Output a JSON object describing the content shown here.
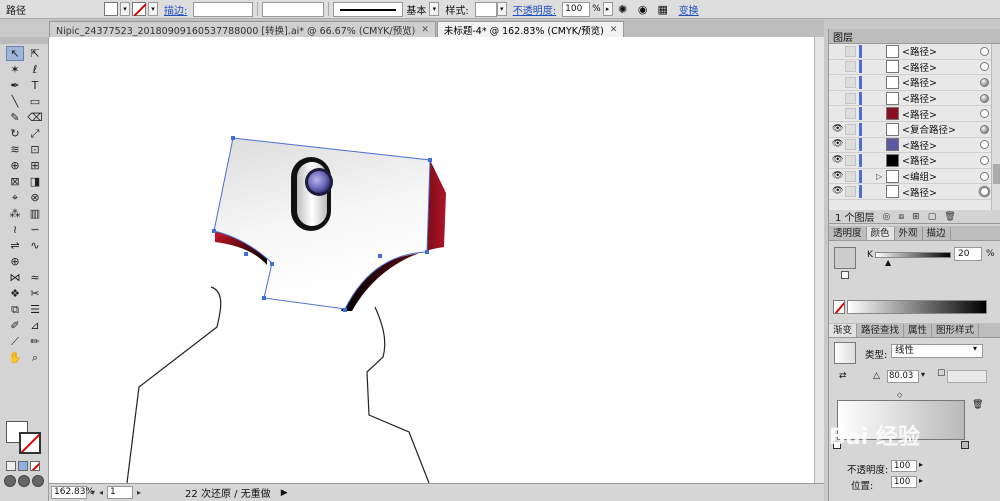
{
  "control_bar": {
    "selection_label": "路径",
    "stroke_label": "描边:",
    "brush_label": "基本",
    "style_label": "样式:",
    "opacity_label": "不透明度:",
    "opacity_value": "100",
    "opacity_unit": "%",
    "transform_label": "变换"
  },
  "tabs": [
    {
      "label": "Nipic_24377523_20180909160537788000 [转换].ai* @ 66.67% (CMYK/预览)"
    },
    {
      "label": "未标题-4* @ 162.83% (CMYK/预览)"
    }
  ],
  "tools": [
    {
      "icon": "selection-icon",
      "glyph": "↖"
    },
    {
      "icon": "direct-selection-icon",
      "glyph": "⇱"
    },
    {
      "icon": "magic-wand-icon",
      "glyph": "✶"
    },
    {
      "icon": "lasso-icon",
      "glyph": "ℓ"
    },
    {
      "icon": "pen-icon",
      "glyph": "✒"
    },
    {
      "icon": "type-icon",
      "glyph": "T"
    },
    {
      "icon": "line-icon",
      "glyph": "╲"
    },
    {
      "icon": "rectangle-icon",
      "glyph": "▭"
    },
    {
      "icon": "paintbrush-icon",
      "glyph": "✎"
    },
    {
      "icon": "eraser-icon",
      "glyph": "⌫"
    },
    {
      "icon": "rotate-icon",
      "glyph": "↻"
    },
    {
      "icon": "scale-icon",
      "glyph": "⤢"
    },
    {
      "icon": "warp-icon",
      "glyph": "≋"
    },
    {
      "icon": "free-transform-icon",
      "glyph": "⊡"
    },
    {
      "icon": "shape-builder-icon",
      "glyph": "⊕"
    },
    {
      "icon": "perspective-icon",
      "glyph": "⊞"
    },
    {
      "icon": "mesh-icon",
      "glyph": "⊠"
    },
    {
      "icon": "gradient-icon",
      "glyph": "◨"
    },
    {
      "icon": "eyedropper-icon",
      "glyph": "⌖"
    },
    {
      "icon": "blend-icon",
      "glyph": "⊗"
    },
    {
      "icon": "symbol-sprayer-icon",
      "glyph": "⁂"
    },
    {
      "icon": "column-graph-icon",
      "glyph": "▥"
    },
    {
      "icon": "width-icon",
      "glyph": "≀"
    },
    {
      "icon": "reshape-icon",
      "glyph": "∽"
    },
    {
      "icon": "join-icon",
      "glyph": "⇌"
    },
    {
      "icon": "smooth-icon",
      "glyph": "∿"
    },
    {
      "icon": "artboard-icon",
      "glyph": "⊕"
    },
    {
      "icon": "slice-icon",
      "glyph": ""
    },
    {
      "icon": "envelope-icon",
      "glyph": "⋈"
    },
    {
      "icon": "wrinkle-icon",
      "glyph": "≈"
    },
    {
      "icon": "crystallize-icon",
      "glyph": "❖"
    },
    {
      "icon": "path-eraser-icon",
      "glyph": "✂"
    },
    {
      "icon": "layer-stack-icon",
      "glyph": "⧉"
    },
    {
      "icon": "align-icon",
      "glyph": "☰"
    },
    {
      "icon": "live-paint-icon",
      "glyph": "✐"
    },
    {
      "icon": "live-paint-select-icon",
      "glyph": "⊿"
    },
    {
      "icon": "knife-icon",
      "glyph": "⟋"
    },
    {
      "icon": "pencil-icon",
      "glyph": "✏"
    },
    {
      "icon": "hand-icon",
      "glyph": "✋"
    },
    {
      "icon": "zoom-icon",
      "glyph": "⌕"
    }
  ],
  "status_bar": {
    "zoom": "162.83%",
    "page": "1",
    "message": "22 次还原 / 无重做"
  },
  "layers_panel": {
    "title": "图层",
    "rows": [
      {
        "name": "<路径>",
        "thumb": "#ffffff",
        "visible": false,
        "target": "circ"
      },
      {
        "name": "<路径>",
        "thumb": "#ffffff",
        "visible": false,
        "target": "circ"
      },
      {
        "name": "<路径>",
        "thumb": "#ffffff",
        "visible": false,
        "target": "filled"
      },
      {
        "name": "<路径>",
        "thumb": "#ffffff",
        "visible": false,
        "target": "filled"
      },
      {
        "name": "<路径>",
        "thumb": "#8a1020",
        "visible": false,
        "target": "circ"
      },
      {
        "name": "<复合路径>",
        "thumb": "#ffffff",
        "visible": true,
        "target": "filled"
      },
      {
        "name": "<路径>",
        "thumb": "#5a5a9e",
        "visible": true,
        "target": "circ"
      },
      {
        "name": "<路径>",
        "thumb": "#000000",
        "visible": true,
        "target": "circ"
      },
      {
        "name": "<编组>",
        "thumb": "#ffffff",
        "visible": true,
        "target": "circ",
        "group": true
      },
      {
        "name": "<路径>",
        "thumb": "#ffffff",
        "visible": true,
        "target": "dbl",
        "selected": true
      }
    ],
    "footer_count": "1 个图层"
  },
  "color_panel": {
    "tabs": [
      "透明度",
      "颜色",
      "外观",
      "描边"
    ],
    "active_tab": "颜色",
    "channel_label": "K",
    "channel_value": "20",
    "unit": "%"
  },
  "gradient_panel": {
    "tabs": [
      "渐变",
      "路径查找",
      "属性",
      "图形样式"
    ],
    "active_tab": "渐变",
    "type_label": "类型:",
    "type_value": "线性",
    "angle_value": "80.03",
    "opacity_label": "不透明度:",
    "opacity_value": "100",
    "position_label": "位置:",
    "position_value": "100"
  },
  "colors": {
    "dark_red": "#8a0f1c",
    "knob_purple": "#7b78c2",
    "selection_blue": "#3d6fd6"
  }
}
